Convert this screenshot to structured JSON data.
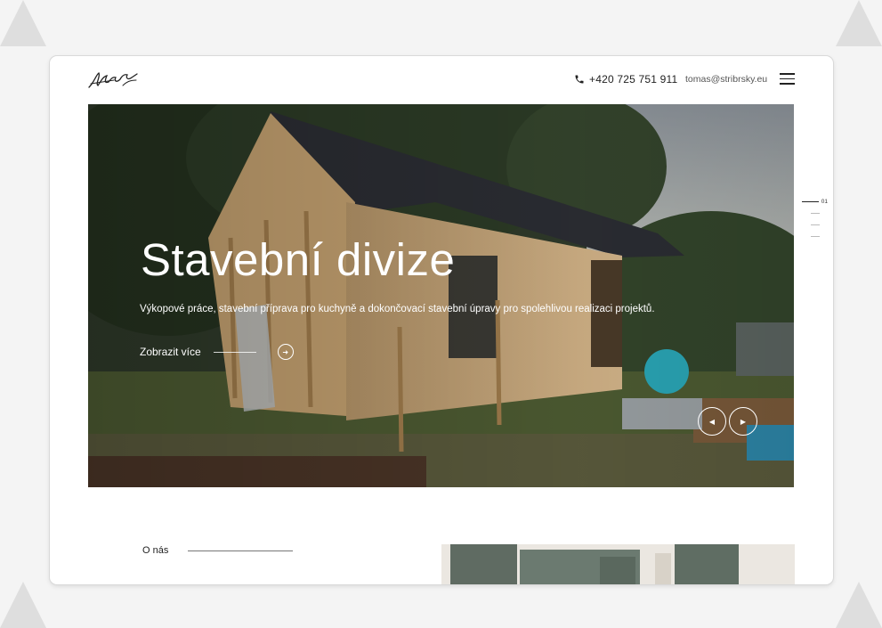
{
  "header": {
    "logo_icon": "signature-logo",
    "phone_icon": "phone-icon",
    "phone": "+420 725 751 911",
    "email": "tomas@stribrsky.eu",
    "menu_icon": "hamburger-menu-icon"
  },
  "hero": {
    "title": "Stavební divize",
    "description": "Výkopové práce, stavební příprava pro kuchyně a dokončovací stavební úpravy pro spolehlivou realizaci projektů.",
    "cta_label": "Zobrazit více",
    "cta_icon": "arrow-right-circle-icon",
    "prev_icon": "chevron-left-icon",
    "next_icon": "chevron-right-icon"
  },
  "pager": {
    "items": [
      "01",
      "",
      "",
      ""
    ],
    "active_index": 0
  },
  "about": {
    "label": "O nás"
  },
  "colors": {
    "text_dark": "#222222",
    "hero_text": "#ffffff",
    "page_bg": "#f4f4f4"
  }
}
